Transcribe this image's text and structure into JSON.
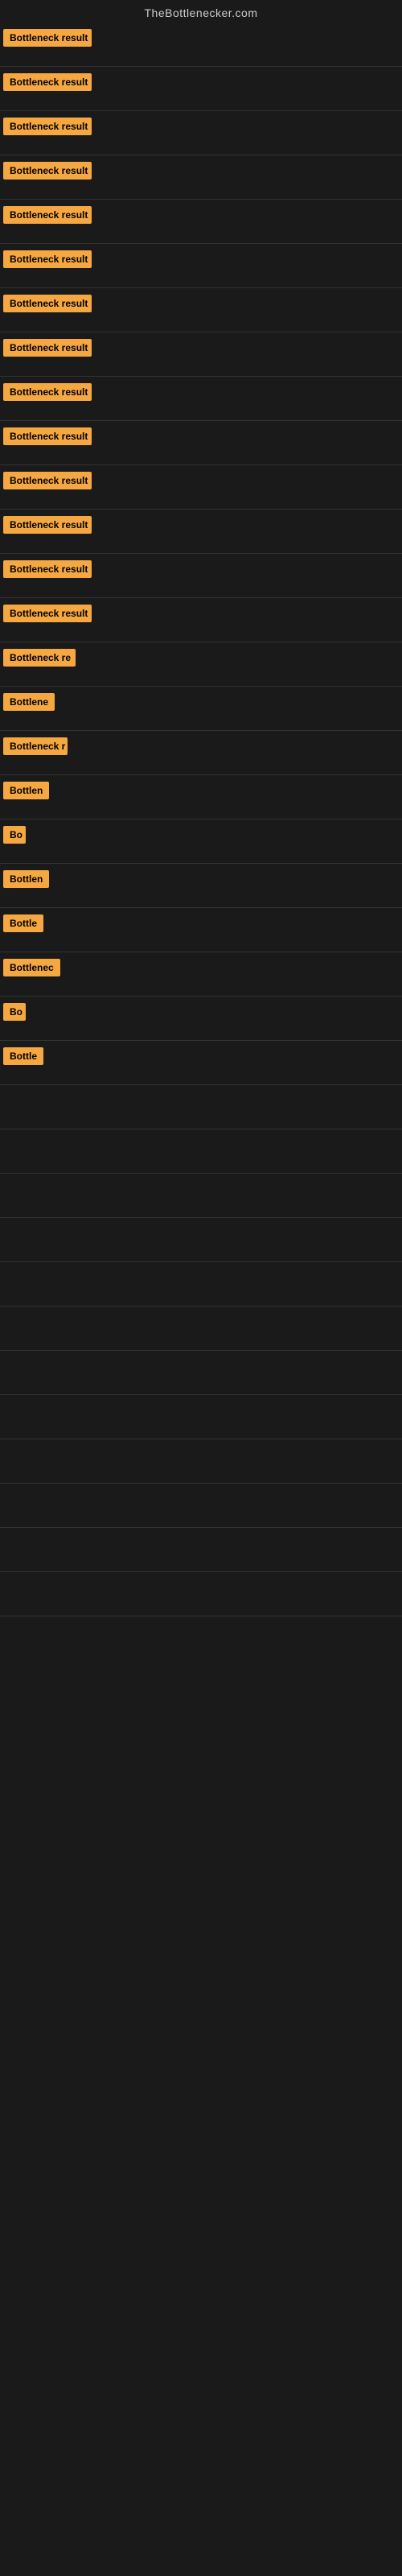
{
  "site": {
    "title": "TheBottlenecker.com"
  },
  "rows": [
    {
      "id": 1,
      "label": "Bottleneck result",
      "width": 110
    },
    {
      "id": 2,
      "label": "Bottleneck result",
      "width": 110
    },
    {
      "id": 3,
      "label": "Bottleneck result",
      "width": 110
    },
    {
      "id": 4,
      "label": "Bottleneck result",
      "width": 110
    },
    {
      "id": 5,
      "label": "Bottleneck result",
      "width": 110
    },
    {
      "id": 6,
      "label": "Bottleneck result",
      "width": 110
    },
    {
      "id": 7,
      "label": "Bottleneck result",
      "width": 110
    },
    {
      "id": 8,
      "label": "Bottleneck result",
      "width": 110
    },
    {
      "id": 9,
      "label": "Bottleneck result",
      "width": 110
    },
    {
      "id": 10,
      "label": "Bottleneck result",
      "width": 110
    },
    {
      "id": 11,
      "label": "Bottleneck result",
      "width": 110
    },
    {
      "id": 12,
      "label": "Bottleneck result",
      "width": 110
    },
    {
      "id": 13,
      "label": "Bottleneck result",
      "width": 110
    },
    {
      "id": 14,
      "label": "Bottleneck result",
      "width": 110
    },
    {
      "id": 15,
      "label": "Bottleneck re",
      "width": 90
    },
    {
      "id": 16,
      "label": "Bottlene",
      "width": 70
    },
    {
      "id": 17,
      "label": "Bottleneck r",
      "width": 80
    },
    {
      "id": 18,
      "label": "Bottlen",
      "width": 60
    },
    {
      "id": 19,
      "label": "Bo",
      "width": 28
    },
    {
      "id": 20,
      "label": "Bottlen",
      "width": 60
    },
    {
      "id": 21,
      "label": "Bottle",
      "width": 50
    },
    {
      "id": 22,
      "label": "Bottlenec",
      "width": 72
    },
    {
      "id": 23,
      "label": "Bo",
      "width": 28
    },
    {
      "id": 24,
      "label": "Bottle",
      "width": 50
    }
  ],
  "accent_color": "#f5a742"
}
